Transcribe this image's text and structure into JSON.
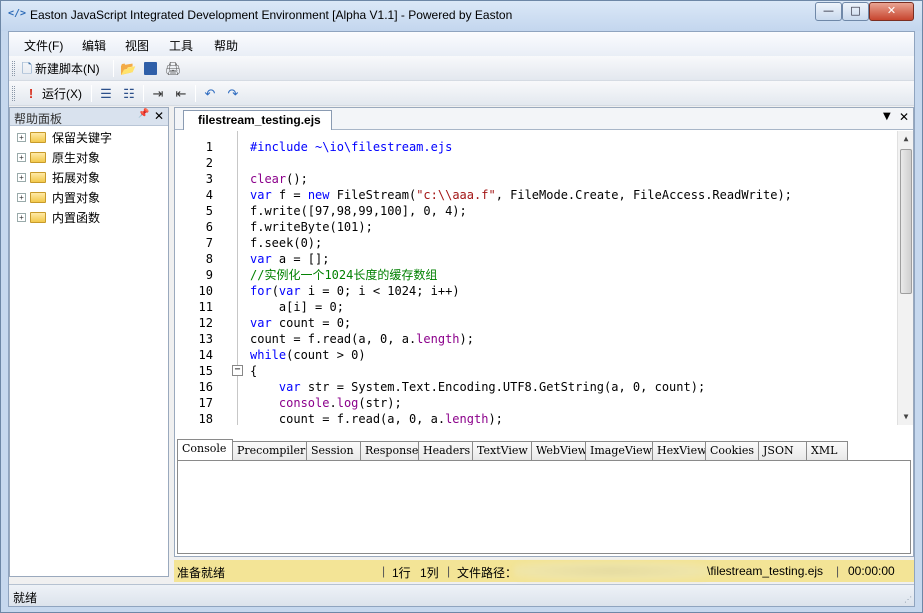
{
  "window": {
    "title": "Easton JavaScript Integrated Development Environment [Alpha V1.1] - Powered by Easton",
    "icon": "code-tag-icon",
    "minimize": "—",
    "maximize": "□",
    "close": "✕"
  },
  "menu": [
    "文件(F)",
    "编辑",
    "视图",
    "工具",
    "帮助"
  ],
  "toolbar1": {
    "new_script": "新建脚本(N)"
  },
  "toolbar2": {
    "run": "运行(X)"
  },
  "help_panel": {
    "title": "帮助面板",
    "pin": "📌",
    "close": "✕",
    "items": [
      "保留关键字",
      "原生对象",
      "拓展对象",
      "内置对象",
      "内置函数"
    ]
  },
  "editor": {
    "tab": "filestream_testing.ejs",
    "lines": [
      {
        "n": "1",
        "html": "<span class=\"inc\">#include ~\\io\\filestream.ejs</span>"
      },
      {
        "n": "2",
        "html": ""
      },
      {
        "n": "3",
        "html": "<span class=\"prop\">clear</span>();"
      },
      {
        "n": "4",
        "html": "<span class=\"kw\">var</span> f = <span class=\"kw\">new</span> FileStream(<span class=\"str\">\"c:\\\\aaa.f\"</span>, FileMode.Create, FileAccess.ReadWrite);"
      },
      {
        "n": "5",
        "html": "f.write([97,98,99,100], 0, 4);"
      },
      {
        "n": "6",
        "html": "f.writeByte(101);"
      },
      {
        "n": "7",
        "html": "f.seek(0);"
      },
      {
        "n": "8",
        "html": "<span class=\"kw\">var</span> a = [];"
      },
      {
        "n": "9",
        "html": "<span class=\"cm\">//实例化一个1024长度的缓存数组</span>"
      },
      {
        "n": "10",
        "html": "<span class=\"kw\">for</span>(<span class=\"kw\">var</span> i = 0; i &lt; 1024; i++)"
      },
      {
        "n": "11",
        "html": "    a[i] = 0;"
      },
      {
        "n": "12",
        "html": "<span class=\"kw\">var</span> count = 0;"
      },
      {
        "n": "13",
        "html": "count = f.read(a, 0, a.<span class=\"prop\">length</span>);"
      },
      {
        "n": "14",
        "html": "<span class=\"kw\">while</span>(count &gt; 0)"
      },
      {
        "n": "15",
        "html": "{"
      },
      {
        "n": "16",
        "html": "    <span class=\"kw\">var</span> str = System.Text.Encoding.UTF8.GetString(a, 0, count);"
      },
      {
        "n": "17",
        "html": "    <span class=\"prop\">console</span>.<span class=\"prop\">log</span>(str);"
      },
      {
        "n": "18",
        "html": "    count = f.read(a, 0, a.<span class=\"prop\">length</span>);"
      }
    ]
  },
  "bottom_tabs": [
    "Console",
    "Precompiler",
    "Session",
    "Response",
    "Headers",
    "TextView",
    "WebView",
    "ImageView",
    "HexView",
    "Cookies",
    "JSON",
    "XML"
  ],
  "editor_status": {
    "state": "准备就绪",
    "row": "1行",
    "col": "1列",
    "path_label": "文件路径：",
    "path_file": "\\filestream_testing.ejs",
    "time": "00:00:00"
  },
  "statusbar": "就绪"
}
